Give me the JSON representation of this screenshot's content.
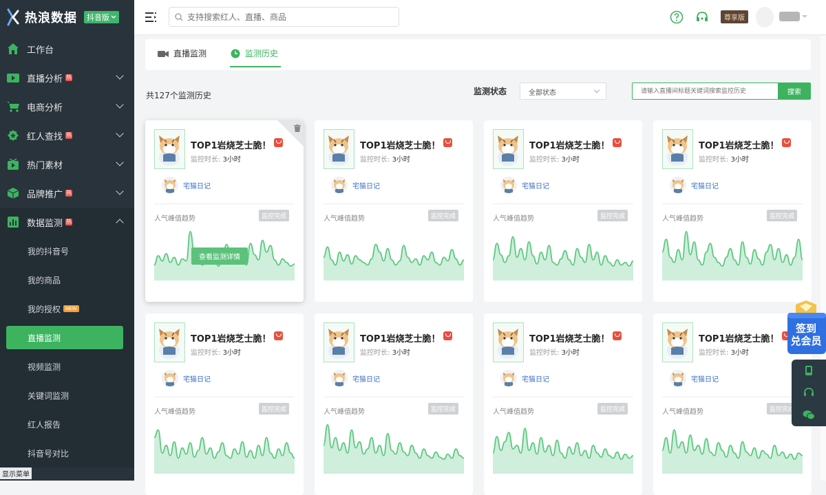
{
  "app": {
    "name": "热浪数据",
    "edition": "抖音版"
  },
  "sidebar": {
    "items": [
      {
        "label": "工作台",
        "icon": "home-icon",
        "hot": false,
        "chevron": "none"
      },
      {
        "label": "直播分析",
        "icon": "live-tv-icon",
        "hot": true,
        "chevron": "down"
      },
      {
        "label": "电商分析",
        "icon": "cart-icon",
        "hot": false,
        "chevron": "down"
      },
      {
        "label": "红人查找",
        "icon": "star-badge-icon",
        "hot": true,
        "chevron": "down"
      },
      {
        "label": "热门素材",
        "icon": "play-box-icon",
        "hot": false,
        "chevron": "down"
      },
      {
        "label": "品牌推广",
        "icon": "cube-icon",
        "hot": true,
        "chevron": "down"
      },
      {
        "label": "数据监测",
        "icon": "bar-chart-icon",
        "hot": true,
        "chevron": "up"
      }
    ],
    "sub_items": [
      {
        "label": "我的抖音号",
        "active": false,
        "new": false
      },
      {
        "label": "我的商品",
        "active": false,
        "new": false
      },
      {
        "label": "我的授权",
        "active": false,
        "new": true
      },
      {
        "label": "直播监测",
        "active": true,
        "new": false
      },
      {
        "label": "视频监测",
        "active": false,
        "new": false
      },
      {
        "label": "关键词监测",
        "active": false,
        "new": false
      },
      {
        "label": "红人报告",
        "active": false,
        "new": false
      },
      {
        "label": "抖音号对比",
        "active": false,
        "new": false
      }
    ],
    "hot_badge": "热",
    "new_badge": "NEW",
    "show_menu": "显示菜单"
  },
  "topbar": {
    "search_placeholder": "支持搜索红人、直播、商品",
    "vip_label": "尊享版"
  },
  "tabs": [
    {
      "label": "直播监测",
      "active": false
    },
    {
      "label": "监测历史",
      "active": true
    }
  ],
  "filters": {
    "count_text": "共127个监测历史",
    "status_label": "监测状态",
    "status_value": "全部状态",
    "keyword_placeholder": "请输入直播间标题关键词搜索监控历史",
    "search_button": "搜索"
  },
  "cards": [
    {
      "title": "TOP1岩烧芝士脆！",
      "duration_label": "监控时长:",
      "duration": "3小时",
      "anchor": "宅猫日记",
      "trend_label": "人气峰值趋势",
      "status": "监控完成",
      "hover": true,
      "detail_button": "查看监测详情",
      "spark": [
        0.3,
        0.48,
        0.38,
        0.52,
        0.35,
        0.45,
        0.3,
        0.42,
        0.38,
        0.95,
        0.55,
        0.4,
        0.3,
        0.35,
        0.5,
        0.45,
        0.28,
        0.4,
        0.7,
        0.55,
        0.35,
        0.62,
        0.48,
        0.3,
        0.72,
        0.5,
        0.4,
        0.78,
        0.55,
        0.68,
        0.4,
        0.3,
        0.42,
        0.35,
        0.28,
        0.32
      ]
    },
    {
      "title": "TOP1岩烧芝士脆！",
      "duration_label": "监控时长:",
      "duration": "3小时",
      "anchor": "宅猫日记",
      "trend_label": "人气峰值趋势",
      "status": "监控完成",
      "hover": false,
      "detail_button": "",
      "spark": [
        0.45,
        0.65,
        0.4,
        0.3,
        0.55,
        0.38,
        0.5,
        0.32,
        0.48,
        0.4,
        0.35,
        0.3,
        0.42,
        0.7,
        0.55,
        0.38,
        0.62,
        0.4,
        0.3,
        0.38,
        0.68,
        0.45,
        0.35,
        0.42,
        0.3,
        0.48,
        0.4,
        0.55,
        0.35,
        0.3,
        0.45,
        0.38,
        0.6,
        0.42,
        0.3,
        0.4
      ]
    },
    {
      "title": "TOP1岩烧芝士脆！",
      "duration_label": "监控时长:",
      "duration": "3小时",
      "anchor": "宅猫日记",
      "trend_label": "人气峰值趋势",
      "status": "监控完成",
      "hover": false,
      "detail_button": "",
      "spark": [
        0.4,
        0.72,
        0.5,
        0.35,
        0.48,
        0.85,
        0.45,
        0.62,
        0.4,
        0.75,
        0.48,
        0.32,
        0.55,
        0.4,
        0.68,
        0.35,
        0.3,
        0.42,
        0.58,
        0.4,
        0.3,
        0.62,
        0.45,
        0.35,
        0.7,
        0.4,
        0.55,
        0.3,
        0.48,
        0.35,
        0.28,
        0.4,
        0.3,
        0.35,
        0.28,
        0.38
      ]
    },
    {
      "title": "TOP1岩烧芝士脆！",
      "duration_label": "监控时长:",
      "duration": "3小时",
      "anchor": "宅猫日记",
      "trend_label": "人气峰值趋势",
      "status": "监控完成",
      "hover": false,
      "detail_button": "",
      "spark": [
        0.55,
        0.8,
        0.45,
        0.35,
        0.6,
        0.4,
        0.95,
        0.5,
        0.75,
        0.4,
        0.3,
        0.55,
        0.72,
        0.45,
        0.35,
        0.28,
        0.45,
        0.62,
        0.4,
        0.3,
        0.75,
        0.45,
        0.32,
        0.6,
        0.42,
        0.3,
        0.55,
        0.7,
        0.4,
        0.62,
        0.35,
        0.5,
        0.3,
        0.45,
        0.8,
        0.4
      ]
    },
    {
      "title": "TOP1岩烧芝士脆！",
      "duration_label": "监控时长:",
      "duration": "3小时",
      "anchor": "宅猫日记",
      "trend_label": "人气峰值趋势",
      "status": "监控完成",
      "hover": false,
      "detail_button": "",
      "spark": [
        0.7,
        0.85,
        0.4,
        0.55,
        0.35,
        0.62,
        0.3,
        0.5,
        0.38,
        0.6,
        0.32,
        0.45,
        0.7,
        0.38,
        0.5,
        0.3,
        0.42,
        0.6,
        0.35,
        0.3,
        0.48,
        0.38,
        0.62,
        0.32,
        0.45,
        0.3,
        0.55,
        0.35,
        0.7,
        0.4,
        0.3,
        0.48,
        0.35,
        0.6,
        0.4,
        0.3
      ]
    },
    {
      "title": "TOP1岩烧芝士脆！",
      "duration_label": "监控时长:",
      "duration": "3小时",
      "anchor": "宅猫日记",
      "trend_label": "人气峰值趋势",
      "status": "监控完成",
      "hover": false,
      "detail_button": "",
      "spark": [
        0.55,
        0.95,
        0.5,
        0.7,
        0.45,
        0.6,
        0.4,
        0.85,
        0.5,
        0.62,
        0.38,
        0.48,
        0.7,
        0.4,
        0.55,
        0.35,
        0.78,
        0.45,
        0.38,
        0.6,
        0.42,
        0.35,
        0.55,
        0.4,
        0.3,
        0.48,
        0.35,
        0.3,
        0.42,
        0.32,
        0.28,
        0.38,
        0.3,
        0.48,
        0.35,
        0.3
      ]
    },
    {
      "title": "TOP1岩烧芝士脆！",
      "duration_label": "监控时长:",
      "duration": "3小时",
      "anchor": "宅猫日记",
      "trend_label": "人气峰值趋势",
      "status": "监控完成",
      "hover": false,
      "detail_button": "",
      "spark": [
        0.4,
        0.72,
        0.45,
        0.62,
        0.8,
        0.48,
        0.55,
        0.4,
        0.88,
        0.45,
        0.6,
        0.38,
        0.7,
        0.42,
        0.55,
        0.35,
        0.65,
        0.4,
        0.3,
        0.52,
        0.38,
        0.6,
        0.35,
        0.45,
        0.3,
        0.55,
        0.4,
        0.32,
        0.48,
        0.35,
        0.3,
        0.42,
        0.28,
        0.38,
        0.3,
        0.35
      ]
    },
    {
      "title": "TOP1岩烧芝士脆！",
      "duration_label": "监控时长:",
      "duration": "3小时",
      "anchor": "宅猫日记",
      "trend_label": "人气峰值趋势",
      "status": "监控完成",
      "hover": false,
      "detail_button": "",
      "spark": [
        0.45,
        0.7,
        0.4,
        0.85,
        0.5,
        0.62,
        0.4,
        0.75,
        0.45,
        0.55,
        0.38,
        0.68,
        0.42,
        0.35,
        0.6,
        0.45,
        0.32,
        0.55,
        0.4,
        0.3,
        0.62,
        0.42,
        0.35,
        0.5,
        0.3,
        0.45,
        0.38,
        0.3,
        0.55,
        0.35,
        0.42,
        0.3,
        0.38,
        0.28,
        0.4,
        0.35
      ]
    }
  ],
  "float": {
    "promo_line1": "签到",
    "promo_line2": "兑会员"
  }
}
